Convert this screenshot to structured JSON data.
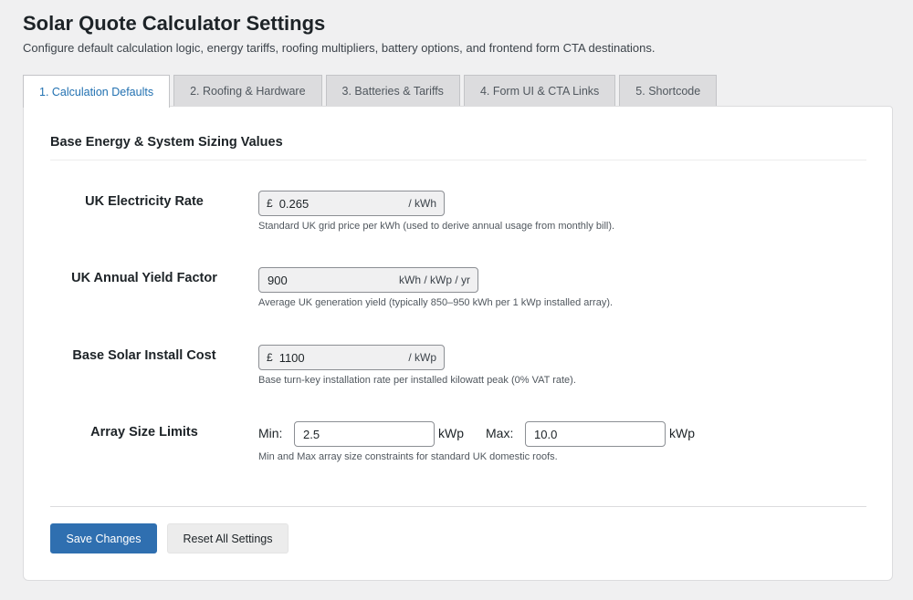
{
  "header": {
    "title": "Solar Quote Calculator Settings",
    "description": "Configure default calculation logic, energy tariffs, roofing multipliers, battery options, and frontend form CTA destinations."
  },
  "tabs": [
    {
      "label": "1. Calculation Defaults",
      "active": true
    },
    {
      "label": "2. Roofing & Hardware",
      "active": false
    },
    {
      "label": "3. Batteries & Tariffs",
      "active": false
    },
    {
      "label": "4. Form UI & CTA Links",
      "active": false
    },
    {
      "label": "5. Shortcode",
      "active": false
    }
  ],
  "section": {
    "title": "Base Energy & System Sizing Values"
  },
  "fields": {
    "electricity_rate": {
      "label": "UK Electricity Rate",
      "prefix": "£",
      "value": "0.265",
      "suffix": "/ kWh",
      "help": "Standard UK grid price per kWh (used to derive annual usage from monthly bill)."
    },
    "yield_factor": {
      "label": "UK Annual Yield Factor",
      "value": "900",
      "suffix": "kWh / kWp / yr",
      "help": "Average UK generation yield (typically 850–950 kWh per 1 kWp installed array)."
    },
    "install_cost": {
      "label": "Base Solar Install Cost",
      "prefix": "£",
      "value": "1100",
      "suffix": "/ kWp",
      "help": "Base turn-key installation rate per installed kilowatt peak (0% VAT rate)."
    },
    "array_limits": {
      "label": "Array Size Limits",
      "min_label": "Min:",
      "min_value": "2.5",
      "max_label": "Max:",
      "max_value": "10.0",
      "unit": "kWp",
      "help": "Min and Max array size constraints for standard UK domestic roofs."
    }
  },
  "actions": {
    "save_label": "Save Changes",
    "reset_label": "Reset All Settings"
  },
  "colors": {
    "primary": "#2f6fb0",
    "active_tab_text": "#2271b1",
    "background": "#f0f0f1"
  }
}
